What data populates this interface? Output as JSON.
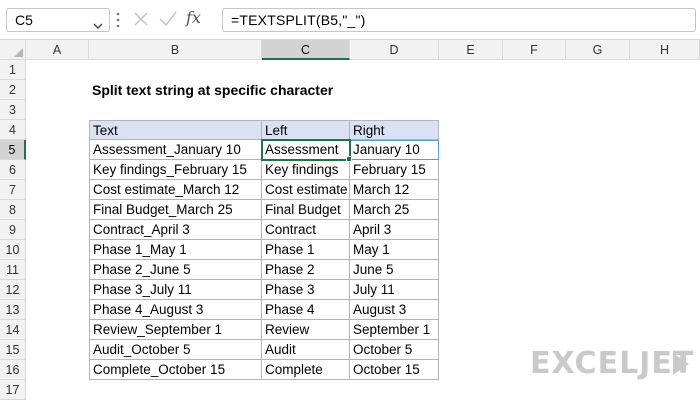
{
  "formula_bar": {
    "name_box": "C5",
    "fx_label": "fx",
    "formula": "=TEXTSPLIT(B5,\"_\")"
  },
  "columns": [
    "A",
    "B",
    "C",
    "D",
    "E",
    "F",
    "G",
    "H"
  ],
  "rows": [
    "1",
    "2",
    "3",
    "4",
    "5",
    "6",
    "7",
    "8",
    "9",
    "10",
    "11",
    "12",
    "13",
    "14",
    "15",
    "16",
    "17"
  ],
  "sheet": {
    "title": "Split text string at specific character",
    "table": {
      "headers": [
        "Text",
        "Left",
        "Right"
      ],
      "rows": [
        [
          "Assessment_January 10",
          "Assessment",
          "January 10"
        ],
        [
          "Key findings_February 15",
          "Key findings",
          "February 15"
        ],
        [
          "Cost estimate_March 12",
          "Cost estimate",
          "March 12"
        ],
        [
          "Final Budget_March 25",
          "Final Budget",
          "March 25"
        ],
        [
          "Contract_April 3",
          "Contract",
          "April 3"
        ],
        [
          "Phase 1_May 1",
          "Phase 1",
          "May 1"
        ],
        [
          "Phase 2_June 5",
          "Phase 2",
          "June 5"
        ],
        [
          "Phase 3_July 11",
          "Phase 3",
          "July 11"
        ],
        [
          "Phase 4_August 3",
          "Phase 4",
          "August 3"
        ],
        [
          "Review_September 1",
          "Review",
          "September 1"
        ],
        [
          "Audit_October 5",
          "Audit",
          "October 5"
        ],
        [
          "Complete_October 15",
          "Complete",
          "October 15"
        ]
      ]
    }
  },
  "logo": {
    "text": "EXCELJET"
  },
  "colors": {
    "header_fill": "#d9e1f2",
    "selection_green": "#217346",
    "spill_blue": "#5b9bd5"
  }
}
